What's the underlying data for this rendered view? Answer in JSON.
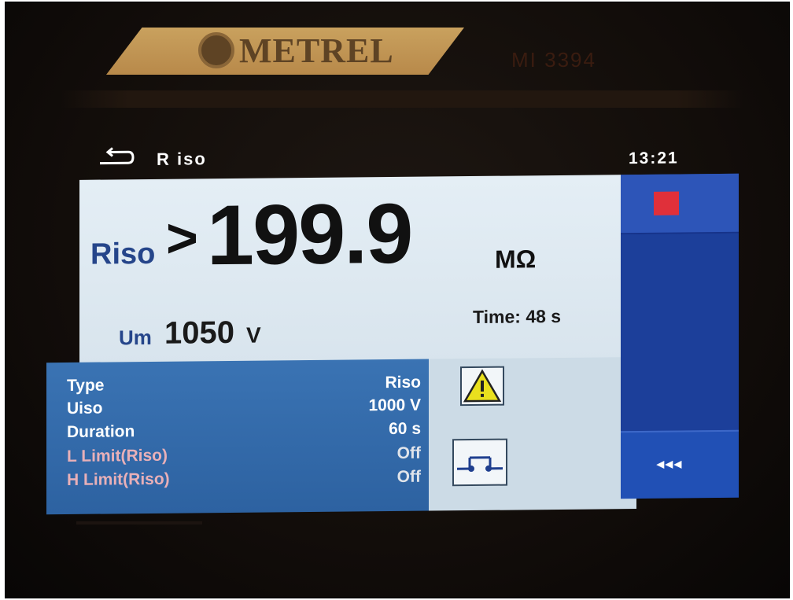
{
  "device": {
    "brand": "METREL",
    "model": "MI 3394"
  },
  "status_bar": {
    "title": "R iso",
    "time": "13:21"
  },
  "result": {
    "riso_label": "Riso",
    "riso_prefix": ">",
    "riso_value": "199.9",
    "riso_unit": "MΩ",
    "um_label": "Um",
    "um_value": "1050",
    "um_unit": "V",
    "time_text": "Time: 48 s"
  },
  "parameters": [
    {
      "label": "Type",
      "value": "Riso"
    },
    {
      "label": "Uiso",
      "value": "1000 V"
    },
    {
      "label": "Duration",
      "value": "60 s"
    },
    {
      "label": "L Limit(Riso)",
      "value": "Off"
    },
    {
      "label": "H Limit(Riso)",
      "value": "Off"
    }
  ],
  "side": {
    "more_label": "◂◂◂"
  },
  "icons": {
    "back": "back-arrow-icon",
    "warning": "warning-triangle-icon",
    "switch": "open-switch-icon",
    "stop": "stop-icon"
  },
  "colors": {
    "accent_blue": "#25458a",
    "panel_blue": "#3a73b3",
    "side_blue": "#1c3f9a",
    "stop_red": "#e0303a",
    "warning_yellow": "#e9e01e"
  }
}
